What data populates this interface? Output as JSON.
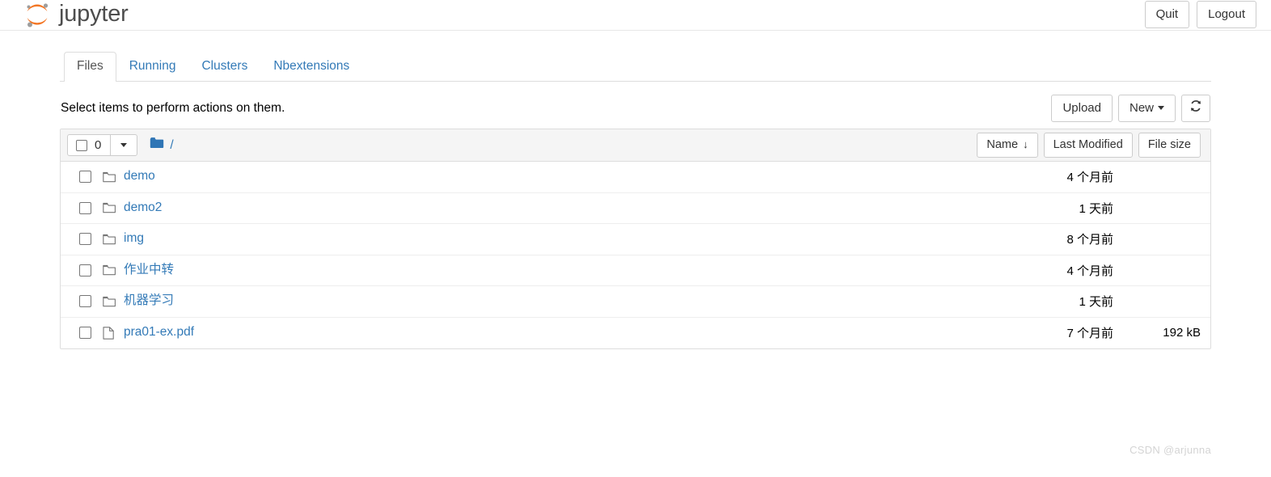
{
  "header": {
    "brand_text": "jupyter",
    "logo_icon": "jupyter-logo-icon",
    "quit_label": "Quit",
    "logout_label": "Logout"
  },
  "tabs": [
    {
      "label": "Files",
      "active": true
    },
    {
      "label": "Running",
      "active": false
    },
    {
      "label": "Clusters",
      "active": false
    },
    {
      "label": "Nbextensions",
      "active": false
    }
  ],
  "action_bar": {
    "instruction": "Select items to perform actions on them.",
    "upload_label": "Upload",
    "new_label": "New",
    "refresh_icon": "refresh-icon"
  },
  "list_header": {
    "selected_count": "0",
    "select_all_checkbox": "select-all-checkbox",
    "dropdown_icon": "chevron-down-icon",
    "breadcrumb_root": "/",
    "breadcrumb_folder_icon": "folder-icon",
    "sort_name": "Name",
    "sort_name_arrow": "↓",
    "sort_modified": "Last Modified",
    "sort_size": "File size"
  },
  "files": [
    {
      "name": "demo",
      "type": "folder",
      "modified": "4 个月前",
      "size": ""
    },
    {
      "name": "demo2",
      "type": "folder",
      "modified": "1 天前",
      "size": ""
    },
    {
      "name": "img",
      "type": "folder",
      "modified": "8 个月前",
      "size": ""
    },
    {
      "name": "作业中转",
      "type": "folder",
      "modified": "4 个月前",
      "size": ""
    },
    {
      "name": "机器学习",
      "type": "folder",
      "modified": "1 天前",
      "size": ""
    },
    {
      "name": "pra01-ex.pdf",
      "type": "file",
      "modified": "7 个月前",
      "size": "192 kB"
    }
  ],
  "watermark": "CSDN @arjunna",
  "colors": {
    "link": "#337ab7",
    "logo_orange": "#f37726",
    "logo_gray": "#9e9e9e",
    "header_bg": "#f5f5f5",
    "border": "#dddddd"
  }
}
